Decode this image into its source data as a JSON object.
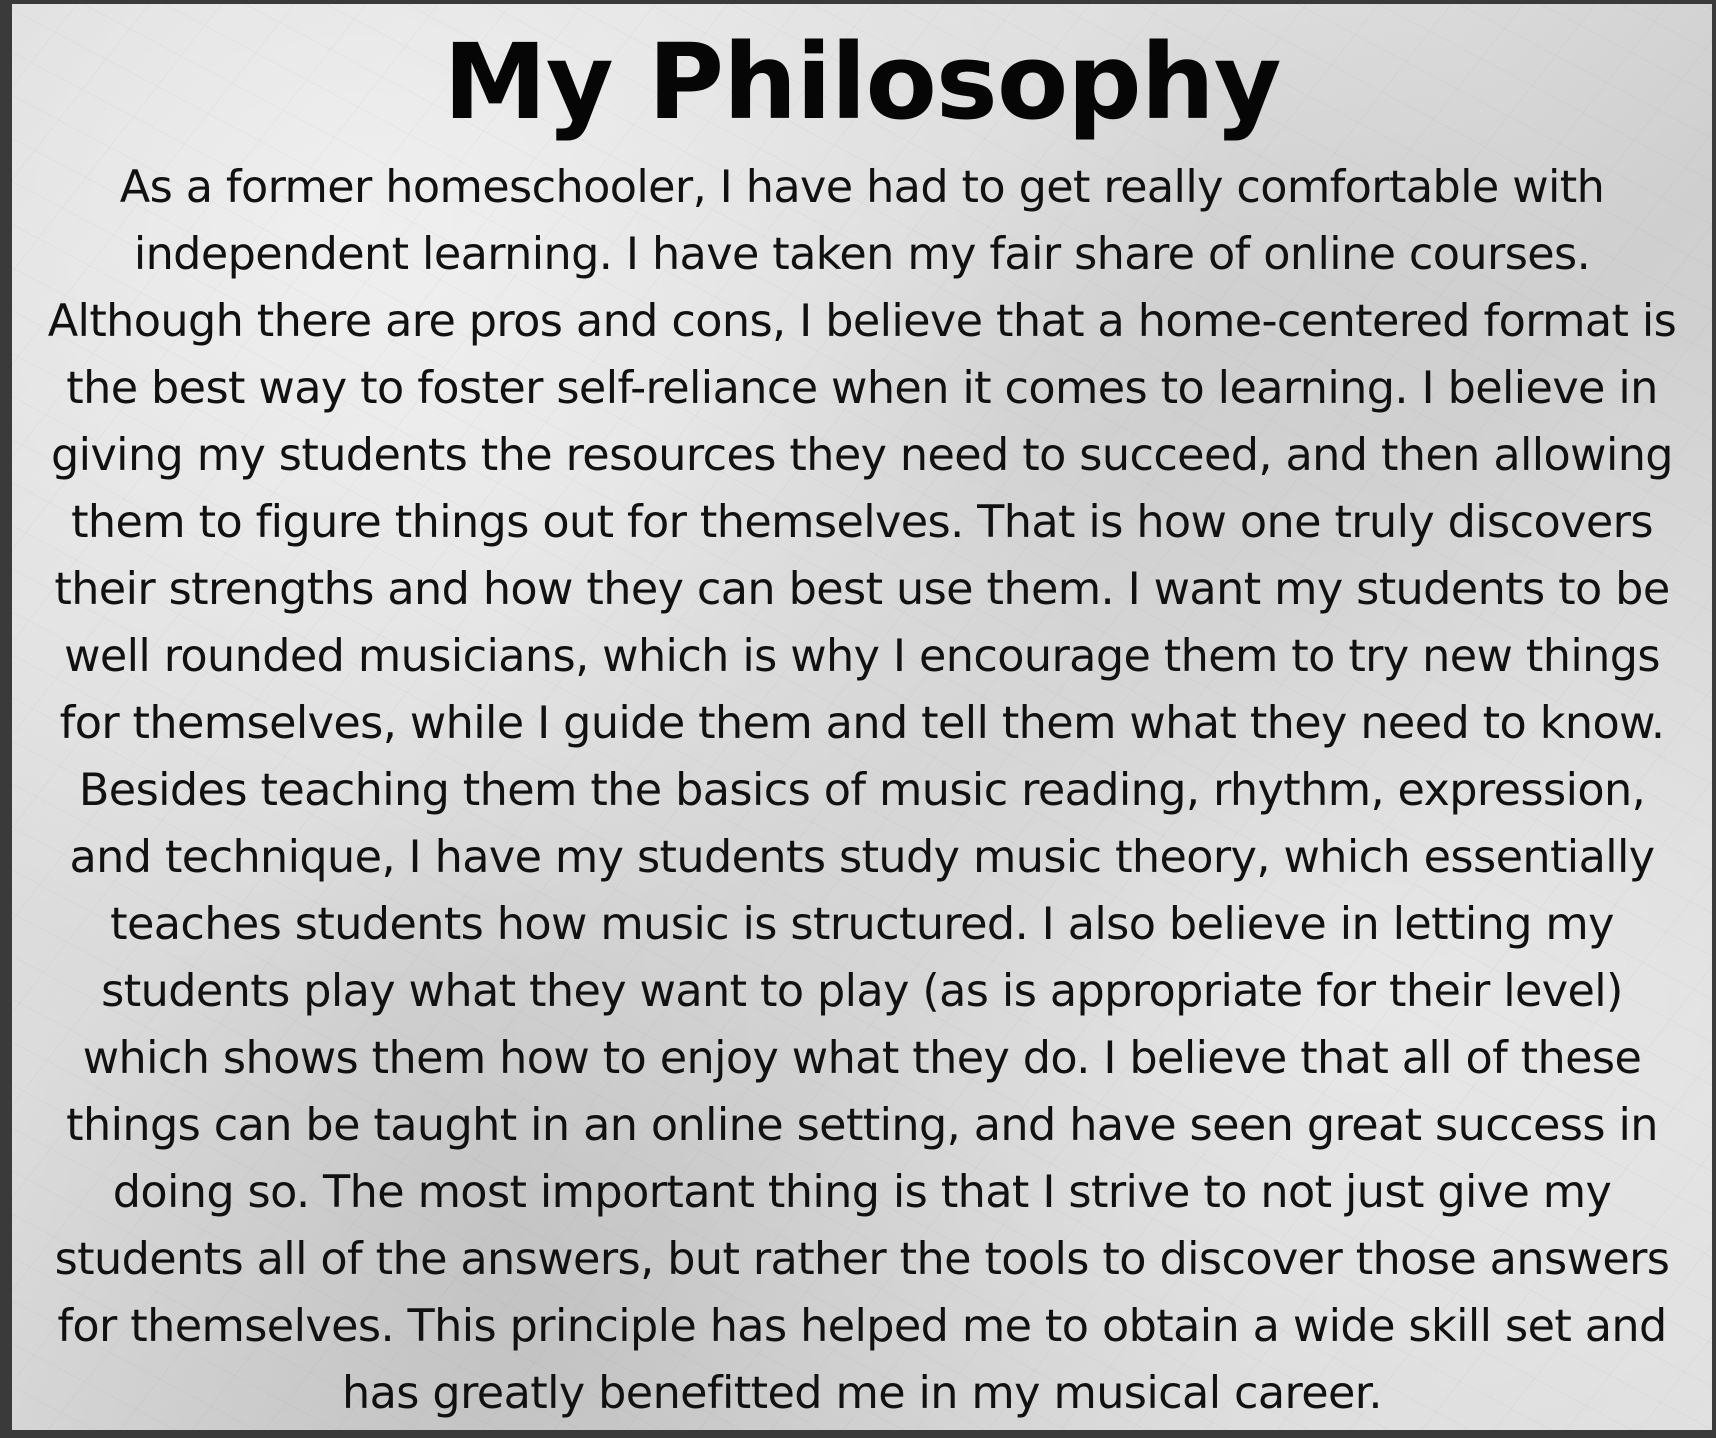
{
  "title": "My Philosophy",
  "lines": [
    "As a former homeschooler, I have had to get really comfortable with",
    "independent learning. I have taken my fair share of online courses.",
    "Although there are pros and cons, I believe that a home-centered format is",
    "the best way to foster self-reliance when it comes to learning. I believe in",
    "giving my students the resources they need to succeed, and then allowing",
    "them to figure things out for themselves. That is how one truly discovers",
    "their strengths and how they can best use them. I want my students to be",
    "well rounded musicians, which is why I encourage them to try new things",
    "for themselves, while I guide them and tell them what they need to know.",
    "Besides teaching them the basics of music reading, rhythm, expression,",
    "and technique, I have my students study music theory, which essentially",
    "teaches students how music is structured. I also believe in letting my",
    "students play what they want to play (as is appropriate for their level)",
    "which shows them how to enjoy what they do. I believe that all of these",
    "things can be taught in an online setting, and have seen great success in",
    "doing so. The most important thing is that I strive to not just give my",
    "students all of the answers, but rather the tools to discover those answers",
    "for themselves.  This principle has helped me to obtain a wide skill set and",
    "has greatly benefitted me in my musical career."
  ]
}
